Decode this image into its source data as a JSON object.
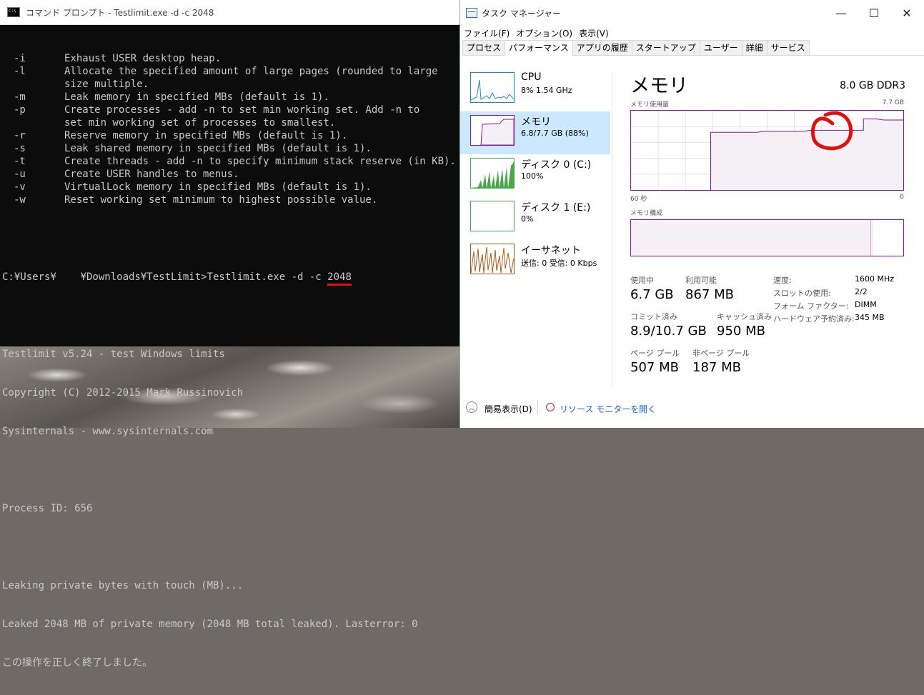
{
  "cmd": {
    "title": "コマンド プロンプト - Testlimit.exe  -d -c 2048",
    "switches": [
      {
        "flag": "-i",
        "desc": "Exhaust USER desktop heap."
      },
      {
        "flag": "-l",
        "desc": "Allocate the specified amount of large pages (rounded to large",
        "cont": "size multiple."
      },
      {
        "flag": "-m",
        "desc": "Leak memory in specified MBs (default is 1)."
      },
      {
        "flag": "-p",
        "desc": "Create processes - add -n to set min working set. Add -n to",
        "cont": "set min working set of processes to smallest."
      },
      {
        "flag": "-r",
        "desc": "Reserve memory in specified MBs (default is 1)."
      },
      {
        "flag": "-s",
        "desc": "Leak shared memory in specified MBs (default is 1)."
      },
      {
        "flag": "-t",
        "desc": "Create threads - add -n to specify minimum stack reserve (in KB)."
      },
      {
        "flag": "-u",
        "desc": "Create USER handles to menus."
      },
      {
        "flag": "-v",
        "desc": "VirtualLock memory in specified MBs (default is 1)."
      },
      {
        "flag": "-w",
        "desc": "Reset working set minimum to highest possible value."
      }
    ],
    "prompt": "C:¥Users¥    ¥Downloads¥TestLimit>Testlimit.exe -d -c ",
    "prompt_arg": "2048",
    "banner1": "Testlimit v5.24 - test Windows limits",
    "banner2": "Copyright (C) 2012-2015 Mark Russinovich",
    "banner3": "Sysinternals - www.sysinternals.com",
    "pid": "Process ID: 656",
    "leak1": "Leaking private bytes with touch (MB)...",
    "leak2": "Leaked 2048 MB of private memory (2048 MB total leaked). Lasterror: 0",
    "done": "この操作を正しく終了しました。"
  },
  "tm": {
    "title": "タスク マネージャー",
    "menu": [
      "ファイル(F)",
      "オプション(O)",
      "表示(V)"
    ],
    "tabs": [
      "プロセス",
      "パフォーマンス",
      "アプリの履歴",
      "スタートアップ",
      "ユーザー",
      "詳細",
      "サービス"
    ],
    "active_tab": 1,
    "resources": [
      {
        "name": "CPU",
        "value": "8%  1.54 GHz"
      },
      {
        "name": "メモリ",
        "value": "6.8/7.7 GB (88%)"
      },
      {
        "name": "ディスク 0 (C:)",
        "value": "100%"
      },
      {
        "name": "ディスク 1 (E:)",
        "value": "0%"
      },
      {
        "name": "イーサネット",
        "value": "送信: 0 受信: 0 Kbps"
      }
    ],
    "selected_resource": 1,
    "heading": "メモリ",
    "spec": "8.0 GB DDR3",
    "usage_label": "メモリ使用量",
    "usage_max": "7.7 GB",
    "x_left": "60 秒",
    "x_right": "0",
    "composition_label": "メモリ構成",
    "usage_graph": {
      "values_gb": [
        0,
        0,
        0,
        0,
        0,
        0,
        0,
        0,
        0,
        0,
        0,
        0,
        5.6,
        5.6,
        5.6,
        5.6,
        5.6,
        5.6,
        5.6,
        5.6,
        5.7,
        5.7,
        5.7,
        5.7,
        5.7,
        5.7,
        5.7,
        5.8,
        5.8,
        5.8,
        5.8,
        5.8,
        5.8,
        5.8,
        5.8,
        6.9,
        6.9,
        6.9,
        6.8,
        6.8,
        6.8,
        6.8
      ],
      "max_gb": 7.7
    },
    "composition": {
      "in_use_fraction": 0.88
    },
    "colors": {
      "accent": "#8b12ae",
      "fill": "#f4f0f5",
      "select": "#cce8ff",
      "annotation": "#e01010"
    },
    "stats": {
      "in_use_label": "使用中",
      "in_use": "6.7 GB",
      "available_label": "利用可能",
      "available": "867 MB",
      "committed_label": "コミット済み",
      "committed": "8.9/10.7 GB",
      "cached_label": "キャッシュ済み",
      "cached": "950 MB",
      "paged_label": "ページ プール",
      "paged": "507 MB",
      "nonpaged_label": "非ページ プール",
      "nonpaged": "187 MB"
    },
    "kv": [
      {
        "k": "速度:",
        "v": "1600 MHz"
      },
      {
        "k": "スロットの使用:",
        "v": "2/2"
      },
      {
        "k": "フォーム ファクター:",
        "v": "DIMM"
      },
      {
        "k": "ハードウェア予約済み:",
        "v": "345 MB"
      }
    ],
    "brief_label": "簡易表示(D)",
    "resmon_label": "リソース モニターを開く"
  }
}
